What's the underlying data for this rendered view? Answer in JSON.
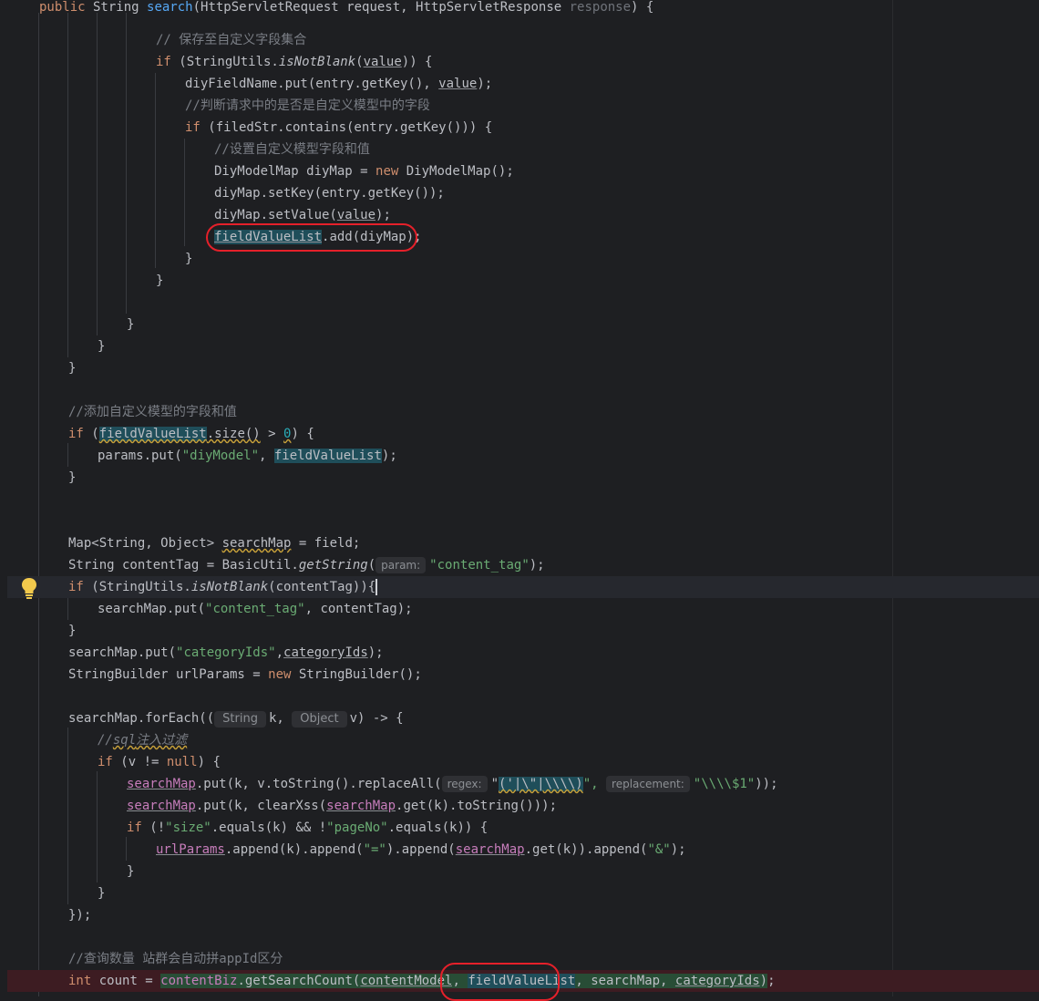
{
  "editor": {
    "lines": [
      {
        "id": "l0",
        "tokens": [
          {
            "t": "public",
            "c": "kw"
          },
          {
            "t": " String "
          },
          {
            "t": "search",
            "c": "fn"
          },
          {
            "t": "(HttpServletRequest request, HttpServletResponse "
          },
          {
            "t": "response",
            "c": "muted"
          },
          {
            "t": ") {"
          }
        ]
      },
      {
        "id": "l1",
        "tokens": [
          {
            "t": "// 保存至自定义字段集合",
            "c": "cmt"
          }
        ]
      },
      {
        "id": "l2",
        "tokens": [
          {
            "t": "if",
            "c": "kw"
          },
          {
            "t": " (StringUtils."
          },
          {
            "t": "isNotBlank",
            "c": "it"
          },
          {
            "t": "("
          },
          {
            "t": "value",
            "c": "ul"
          },
          {
            "t": ")) {"
          }
        ]
      },
      {
        "id": "l3",
        "tokens": [
          {
            "t": "diyFieldName.put(entry.getKey(), "
          },
          {
            "t": "value",
            "c": "ul"
          },
          {
            "t": ");"
          }
        ]
      },
      {
        "id": "l4",
        "tokens": [
          {
            "t": "//判断请求中的是否是自定义模型中的字段",
            "c": "cmt"
          }
        ]
      },
      {
        "id": "l5",
        "tokens": [
          {
            "t": "if",
            "c": "kw"
          },
          {
            "t": " (filedStr.contains(entry.getKey())) {"
          }
        ]
      },
      {
        "id": "l6",
        "tokens": [
          {
            "t": "//设置自定义模型字段和值",
            "c": "cmt"
          }
        ]
      },
      {
        "id": "l7",
        "tokens": [
          {
            "t": "DiyModelMap diyMap = "
          },
          {
            "t": "new",
            "c": "kw"
          },
          {
            "t": " DiyModelMap();"
          }
        ]
      },
      {
        "id": "l8",
        "tokens": [
          {
            "t": "diyMap.setKey(entry.getKey());"
          }
        ]
      },
      {
        "id": "l9",
        "tokens": [
          {
            "t": "diyMap.setValue("
          },
          {
            "t": "value",
            "c": "ul"
          },
          {
            "t": ");"
          }
        ]
      },
      {
        "id": "l10",
        "tokens": [
          {
            "t": "fieldValueList",
            "c": "hl ul"
          },
          {
            "t": ".add(diyMap);"
          }
        ]
      },
      {
        "id": "l11",
        "tokens": [
          {
            "t": "}"
          }
        ]
      },
      {
        "id": "l12",
        "tokens": [
          {
            "t": "}"
          }
        ]
      },
      {
        "id": "l13",
        "tokens": [
          {
            "t": "}"
          }
        ]
      },
      {
        "id": "l14",
        "tokens": [
          {
            "t": "}"
          }
        ]
      },
      {
        "id": "l15",
        "tokens": [
          {
            "t": "}"
          }
        ]
      },
      {
        "id": "l16",
        "tokens": [
          {
            "t": "//添加自定义模型的字段和值",
            "c": "cmt"
          }
        ]
      },
      {
        "id": "l17",
        "tokens": [
          {
            "t": "if",
            "c": "kw"
          },
          {
            "t": " ("
          },
          {
            "t": "fieldValueList",
            "c": "hl ul wavy"
          },
          {
            "t": ".size()",
            "c": "wavy"
          },
          {
            "t": " > "
          },
          {
            "t": "0",
            "c": "num wavy"
          },
          {
            "t": ") {"
          }
        ]
      },
      {
        "id": "l18",
        "tokens": [
          {
            "t": "params.put("
          },
          {
            "t": "\"diyModel\"",
            "c": "str"
          },
          {
            "t": ", "
          },
          {
            "t": "fieldValueList",
            "c": "hl"
          },
          {
            "t": ");"
          }
        ]
      },
      {
        "id": "l19",
        "tokens": [
          {
            "t": "}"
          }
        ]
      },
      {
        "id": "l20",
        "tokens": [
          {
            "t": "Map<String, Object> "
          },
          {
            "t": "searchMap",
            "c": "wavy"
          },
          {
            "t": " = field;"
          }
        ]
      },
      {
        "id": "l21",
        "tokens": [
          {
            "t": "String contentTag = BasicUtil."
          },
          {
            "t": "getString",
            "c": "it"
          },
          {
            "t": "("
          },
          {
            "t": "param:",
            "hint": "param"
          },
          {
            "t": "\"content_tag\"",
            "c": "str"
          },
          {
            "t": ");"
          }
        ]
      },
      {
        "id": "l22",
        "tokens": [
          {
            "t": "if",
            "c": "kw"
          },
          {
            "t": " (StringUtils."
          },
          {
            "t": "isNotBlank",
            "c": "it"
          },
          {
            "t": "(contentTag))"
          },
          {
            "t": "{",
            "c": "caretbrace"
          }
        ]
      },
      {
        "id": "l23",
        "tokens": [
          {
            "t": "searchMap.put("
          },
          {
            "t": "\"content_tag\"",
            "c": "str"
          },
          {
            "t": ", contentTag);"
          }
        ]
      },
      {
        "id": "l24",
        "tokens": [
          {
            "t": "}"
          }
        ]
      },
      {
        "id": "l25",
        "tokens": [
          {
            "t": "searchMap.put("
          },
          {
            "t": "\"categoryIds\"",
            "c": "str"
          },
          {
            "t": ","
          },
          {
            "t": "categoryIds",
            "c": "ul"
          },
          {
            "t": ");"
          }
        ]
      },
      {
        "id": "l26",
        "tokens": [
          {
            "t": "StringBuilder urlParams = "
          },
          {
            "t": "new",
            "c": "kw"
          },
          {
            "t": " StringBuilder();"
          }
        ]
      },
      {
        "id": "l27",
        "tokens": [
          {
            "t": "searchMap.forEach(("
          },
          {
            "t": "String",
            "hint": "type"
          },
          {
            "t": "k, "
          },
          {
            "t": "Object",
            "hint": "type"
          },
          {
            "t": "v) -> {"
          }
        ]
      },
      {
        "id": "l28",
        "tokens": [
          {
            "t": "//",
            "c": "cmt it"
          },
          {
            "t": "sql",
            "c": "cmt it wavy"
          },
          {
            "t": "注入过滤",
            "c": "cmt it wavy"
          }
        ]
      },
      {
        "id": "l29",
        "tokens": [
          {
            "t": "if",
            "c": "kw"
          },
          {
            "t": " (v != "
          },
          {
            "t": "null",
            "c": "kw"
          },
          {
            "t": ") {"
          }
        ]
      },
      {
        "id": "l30",
        "tokens": [
          {
            "t": "searchMap",
            "c": "purple ul"
          },
          {
            "t": ".put(k, v.toString().replaceAll("
          },
          {
            "t": "regex:",
            "hint": "param"
          },
          {
            "t": "\""
          },
          {
            "t": "('|\\\"|\\\\\\\\)",
            "c": "hl wavy"
          },
          {
            "t": "\", ",
            "c": "str"
          },
          {
            "t": "replacement:",
            "hint": "param"
          },
          {
            "t": "\"\\\\\\\\$1\"",
            "c": "str"
          },
          {
            "t": "));"
          }
        ]
      },
      {
        "id": "l31",
        "tokens": [
          {
            "t": "searchMap",
            "c": "purple ul"
          },
          {
            "t": ".put(k, clearXss("
          },
          {
            "t": "searchMap",
            "c": "purple ul"
          },
          {
            "t": ".get(k).toString()));"
          }
        ]
      },
      {
        "id": "l32",
        "tokens": [
          {
            "t": "if",
            "c": "kw"
          },
          {
            "t": " (!"
          },
          {
            "t": "\"size\"",
            "c": "str"
          },
          {
            "t": ".equals(k) && !"
          },
          {
            "t": "\"pageNo\"",
            "c": "str"
          },
          {
            "t": ".equals(k)) {"
          }
        ]
      },
      {
        "id": "l33",
        "tokens": [
          {
            "t": "urlParams",
            "c": "purple ul"
          },
          {
            "t": ".append(k).append("
          },
          {
            "t": "\"=\"",
            "c": "str"
          },
          {
            "t": ").append("
          },
          {
            "t": "searchMap",
            "c": "purple ul"
          },
          {
            "t": ".get(k)).append("
          },
          {
            "t": "\"&\"",
            "c": "str"
          },
          {
            "t": ");"
          }
        ]
      },
      {
        "id": "l34",
        "tokens": [
          {
            "t": "}"
          }
        ]
      },
      {
        "id": "l35",
        "tokens": [
          {
            "t": "}"
          }
        ]
      },
      {
        "id": "l36",
        "tokens": [
          {
            "t": "});"
          }
        ]
      },
      {
        "id": "l37",
        "tokens": [
          {
            "t": "//查询数量 站群会自动拼appId区分",
            "c": "cmt"
          }
        ]
      },
      {
        "id": "l38",
        "tokens": [
          {
            "t": "int",
            "c": "kw"
          },
          {
            "t": " count = "
          },
          {
            "t": "contentBiz",
            "c": "purple hlg"
          },
          {
            "t": ".getSearchCount(",
            "c": "hlg"
          },
          {
            "t": "contentModel",
            "c": "ul hlg"
          },
          {
            "t": ", ",
            "c": "hlg"
          },
          {
            "t": "fieldValueList",
            "c": "hl"
          },
          {
            "t": ", searchMap, ",
            "c": "hlg"
          },
          {
            "t": "categoryIds",
            "c": "ul hlg"
          },
          {
            "t": ")",
            "c": "hlg"
          },
          {
            "t": ";"
          }
        ]
      }
    ]
  },
  "colors": {
    "background": "#1e1f22",
    "keyword": "#cf8e6d",
    "string": "#6aab73",
    "comment": "#7a7e85",
    "method": "#56a8f5",
    "annotation_circle": "#e5202a"
  },
  "icons": {
    "intention_bulb": "lightbulb-icon"
  }
}
